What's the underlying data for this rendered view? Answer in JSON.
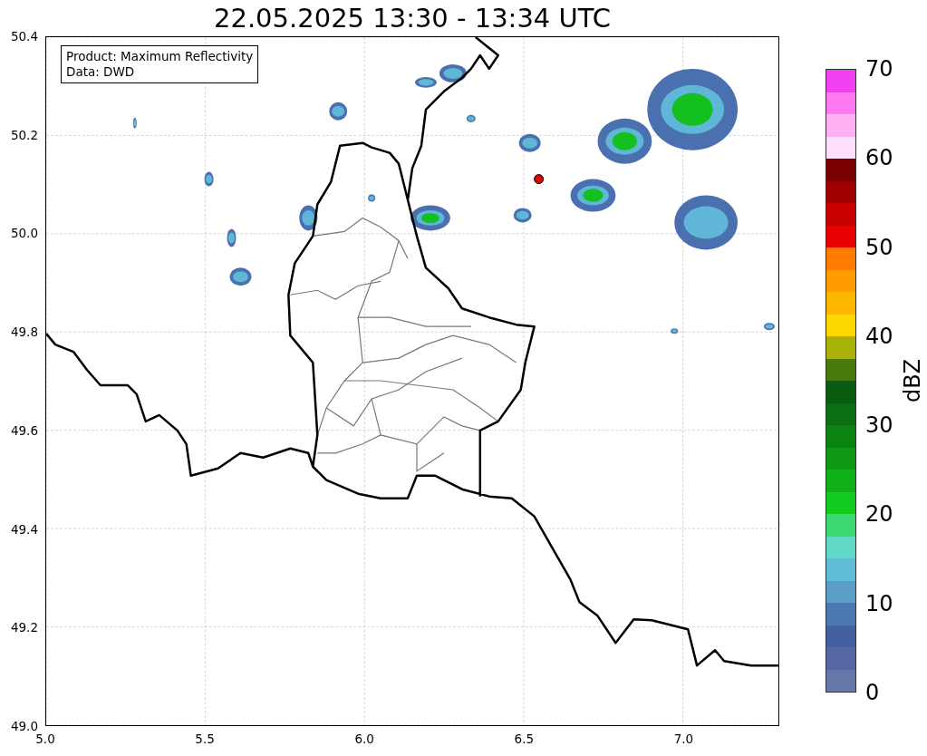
{
  "title": "22.05.2025 13:30 - 13:34 UTC",
  "legend_lines": [
    "Product: Maximum Reflectivity",
    "Data: DWD"
  ],
  "y_ticks": [
    "50.4",
    "50.2",
    "50.0",
    "49.8",
    "49.6",
    "49.4",
    "49.2",
    "49.0"
  ],
  "x_ticks": [
    "5.0",
    "5.5",
    "6.0",
    "6.5",
    "7.0"
  ],
  "colorbar": {
    "label": "dBZ",
    "ticks": [
      "70",
      "60",
      "50",
      "40",
      "30",
      "20",
      "10",
      "0"
    ],
    "segments": [
      {
        "color": "#6577a8"
      },
      {
        "color": "#5467a3"
      },
      {
        "color": "#4460a0"
      },
      {
        "color": "#4a78b0"
      },
      {
        "color": "#5a9ec8"
      },
      {
        "color": "#60bfd8"
      },
      {
        "color": "#60d8c8"
      },
      {
        "color": "#3cd874"
      },
      {
        "color": "#14cc20"
      },
      {
        "color": "#10b018"
      },
      {
        "color": "#0e9a14"
      },
      {
        "color": "#0c8412"
      },
      {
        "color": "#0c7012"
      },
      {
        "color": "#0a5a10"
      },
      {
        "color": "#4a7a0c"
      },
      {
        "color": "#aab00a"
      },
      {
        "color": "#ffd700"
      },
      {
        "color": "#ffb800"
      },
      {
        "color": "#ff9c00"
      },
      {
        "color": "#ff7c00"
      },
      {
        "color": "#e80000"
      },
      {
        "color": "#c80000"
      },
      {
        "color": "#a00000"
      },
      {
        "color": "#780000"
      },
      {
        "color": "#ffe0ff"
      },
      {
        "color": "#ffb0f4"
      },
      {
        "color": "#ff78f0"
      },
      {
        "color": "#f040f0"
      }
    ]
  }
}
